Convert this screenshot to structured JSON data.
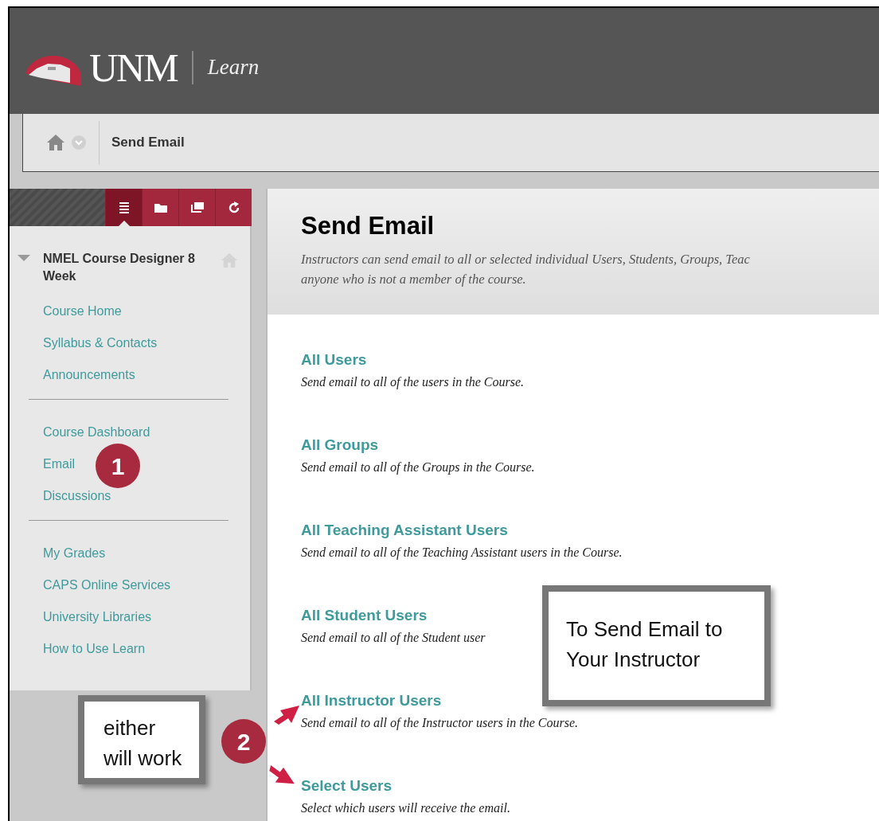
{
  "header": {
    "logo_text": "UNM",
    "product": "Learn"
  },
  "breadcrumb": {
    "current": "Send Email"
  },
  "sidebar": {
    "tabs": [
      {
        "selected": true
      },
      {
        "selected": false
      },
      {
        "selected": false
      },
      {
        "selected": false
      }
    ],
    "course_title": "NMEL Course Designer 8 Week",
    "expanded": true,
    "groups": [
      [
        "Course Home",
        "Syllabus & Contacts",
        "Announcements"
      ],
      [
        "Course Dashboard",
        "Email",
        "Discussions"
      ],
      [
        "My Grades",
        "CAPS Online Services",
        "University Libraries",
        "How to Use Learn"
      ]
    ]
  },
  "page": {
    "title": "Send Email",
    "description": [
      "Instructors can send email to all or selected individual Users, Students, Groups, Teac",
      "anyone who is not a member of the course."
    ],
    "options": [
      {
        "title": "All Users",
        "description": "Send email to all of the users in the Course."
      },
      {
        "title": "All Groups",
        "description": "Send email to all of the Groups in the Course."
      },
      {
        "title": "All Teaching Assistant Users",
        "description": "Send email to all of the Teaching Assistant users in the Course."
      },
      {
        "title": "All Student Users",
        "description": "Send email to all of the Student user"
      },
      {
        "title": "All Instructor Users",
        "description": "Send email to all of the Instructor users in the Course."
      },
      {
        "title": "Select Users",
        "description": "Select which users will receive the email."
      }
    ]
  },
  "annotations": {
    "badges": [
      "1",
      "2"
    ],
    "callouts": [
      "To Send Email to Your Instructor",
      "either will work"
    ]
  }
}
